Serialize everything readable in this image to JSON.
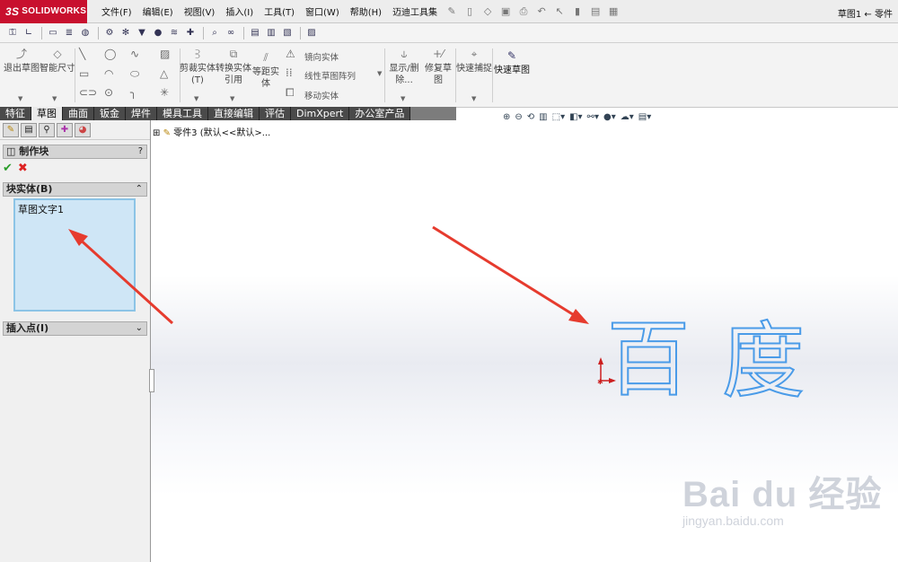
{
  "app": {
    "brand": "SOLIDWORKS",
    "brand_mark": "3S",
    "title": "草图1 ← 零件"
  },
  "menu": [
    "文件(F)",
    "编辑(E)",
    "视图(V)",
    "插入(I)",
    "工具(T)",
    "窗口(W)",
    "帮助(H)",
    "迈迪工具集"
  ],
  "command_manager": {
    "exit_sketch": "退出草图",
    "smart_dimension": "智能尺寸",
    "trim_entities": "剪裁实体(T)",
    "convert_entities": "转换实体引用",
    "offset_entities": "等距实体",
    "mirror_entities": "镜向实体",
    "linear_pattern": "线性草图阵列",
    "move_entities": "移动实体",
    "display_delete": "显示/删除...",
    "repair_sketch": "修复草图",
    "quick_snaps": "快速捕捉",
    "rapid_sketch": "快速草图"
  },
  "tabs": [
    "特征",
    "草图",
    "曲面",
    "钣金",
    "焊件",
    "模具工具",
    "直接编辑",
    "评估",
    "DimXpert",
    "办公室产品"
  ],
  "active_tab": "草图",
  "panel": {
    "title": "制作块",
    "help": "?",
    "section_block": "块实体(B)",
    "block_items": [
      "草图文字1"
    ],
    "section_insert": "插入点(I)"
  },
  "tree": {
    "root": "零件3  (默认<<默认>..."
  },
  "sketch_text": [
    "百",
    "度"
  ],
  "watermark": {
    "brand": "Bai du 经验",
    "url": "jingyan.baidu.com"
  },
  "colors": {
    "brand_red": "#c8102e",
    "sketch_blue": "#4a9be8",
    "annotation_red": "#e63b2e"
  }
}
